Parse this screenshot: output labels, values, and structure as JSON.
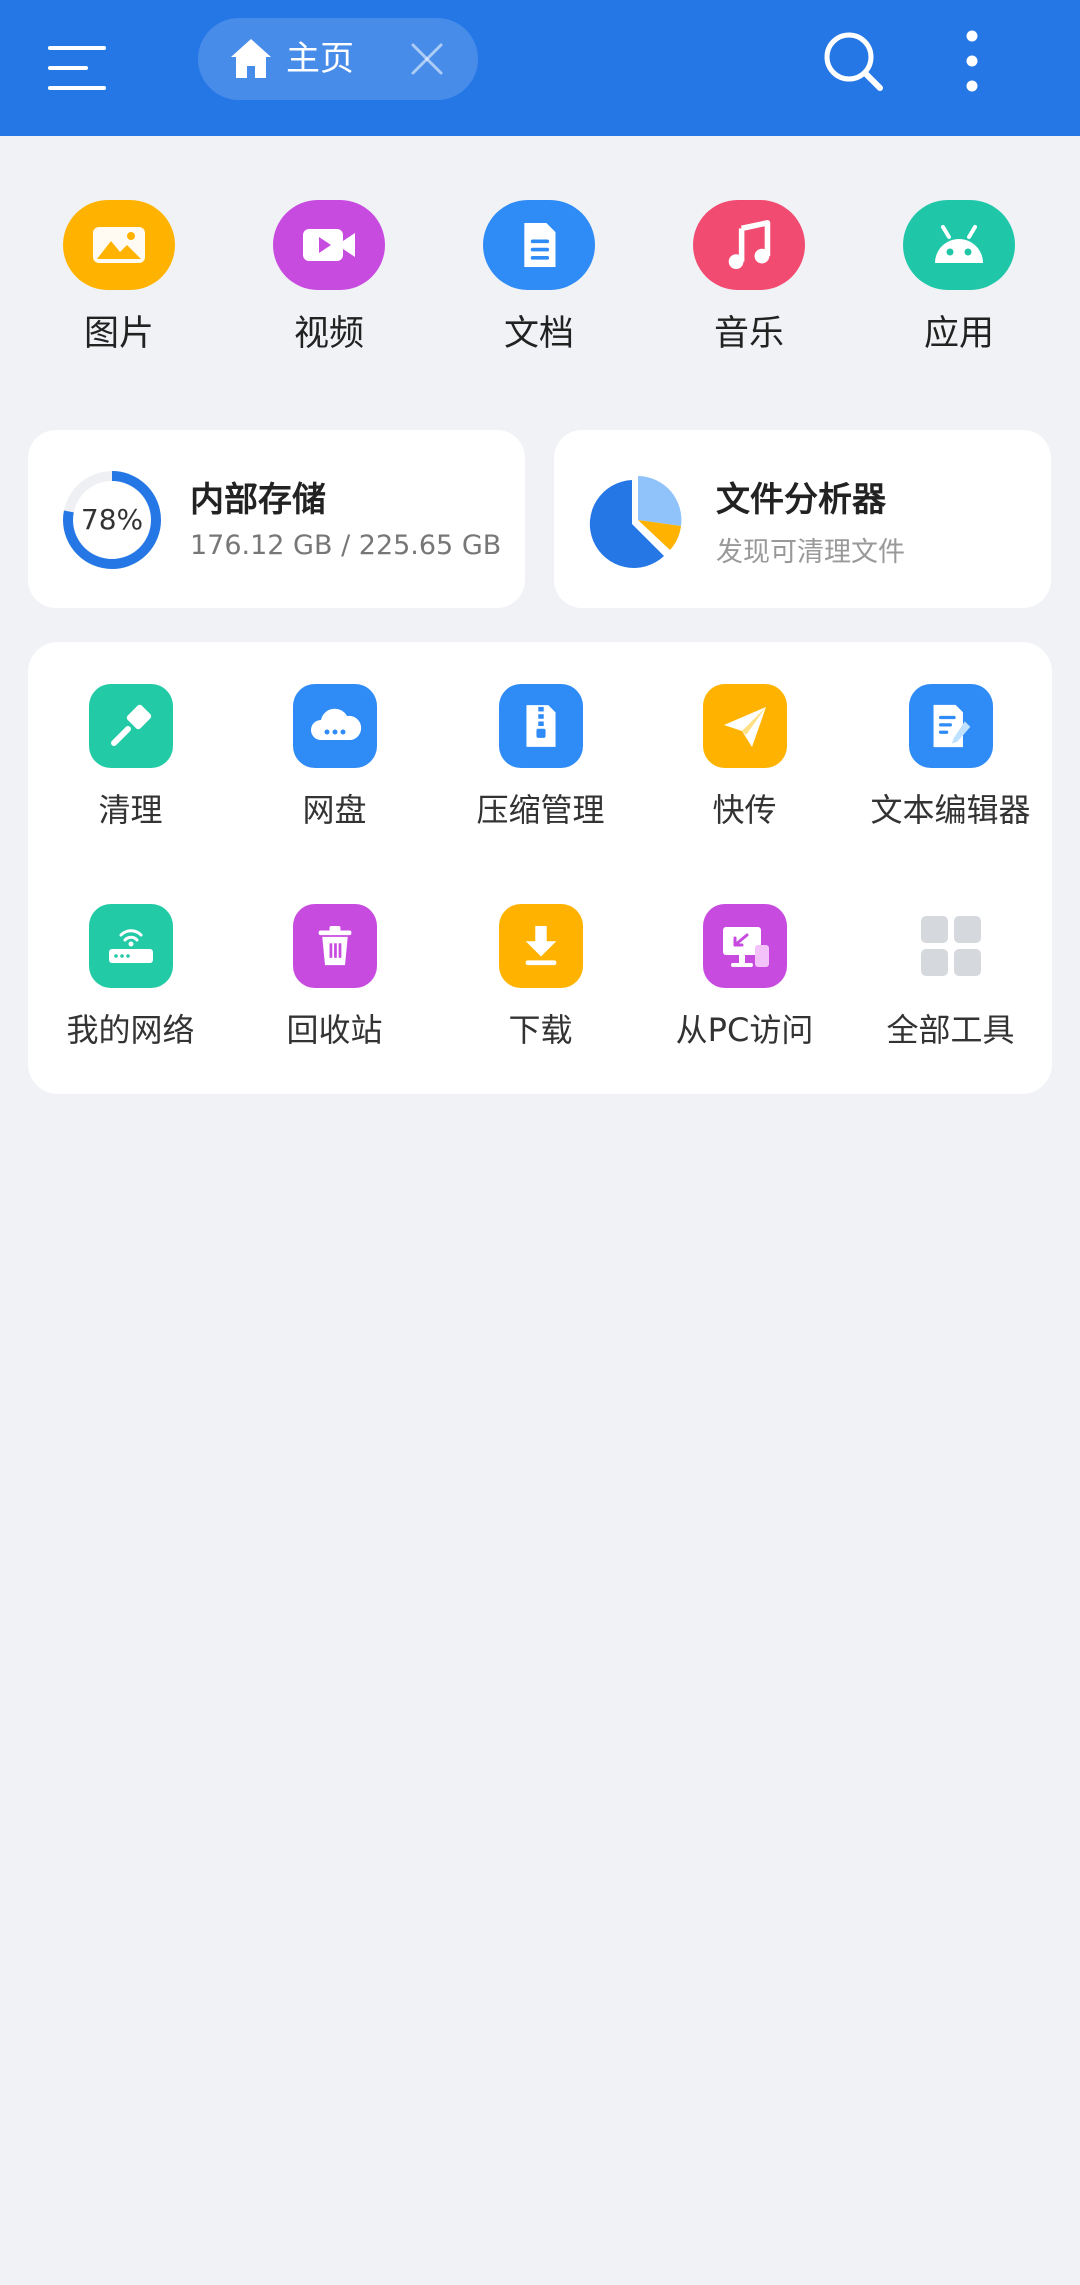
{
  "header": {
    "tab_label": "主页"
  },
  "categories": [
    {
      "label": "图片",
      "icon": "image-icon",
      "color": "#FFB300"
    },
    {
      "label": "视频",
      "icon": "video-icon",
      "color": "#C84BE0"
    },
    {
      "label": "文档",
      "icon": "document-icon",
      "color": "#2F8BF5"
    },
    {
      "label": "音乐",
      "icon": "music-icon",
      "color": "#F24B72"
    },
    {
      "label": "应用",
      "icon": "android-icon",
      "color": "#1FC7A8"
    }
  ],
  "storage": {
    "title": "内部存储",
    "usage_text": "176.12 GB / 225.65 GB",
    "percent_label": "78%",
    "percent": 78
  },
  "analyzer": {
    "title": "文件分析器",
    "subtitle": "发现可清理文件"
  },
  "tools": [
    {
      "label": "清理",
      "icon": "broom-icon",
      "color": "#22CBA5"
    },
    {
      "label": "网盘",
      "icon": "cloud-icon",
      "color": "#2F8BF5"
    },
    {
      "label": "压缩管理",
      "icon": "zip-icon",
      "color": "#2F8BF5"
    },
    {
      "label": "快传",
      "icon": "send-icon",
      "color": "#FFB300"
    },
    {
      "label": "文本编辑器",
      "icon": "text-editor-icon",
      "color": "#2F8BF5"
    },
    {
      "label": "我的网络",
      "icon": "router-icon",
      "color": "#22CBA5"
    },
    {
      "label": "回收站",
      "icon": "trash-icon",
      "color": "#C84BE0"
    },
    {
      "label": "下载",
      "icon": "download-icon",
      "color": "#FFB300"
    },
    {
      "label": "从PC访问",
      "icon": "pc-access-icon",
      "color": "#C84BE0"
    },
    {
      "label": "全部工具",
      "icon": "grid-icon",
      "color": "#D5D8DD"
    }
  ]
}
